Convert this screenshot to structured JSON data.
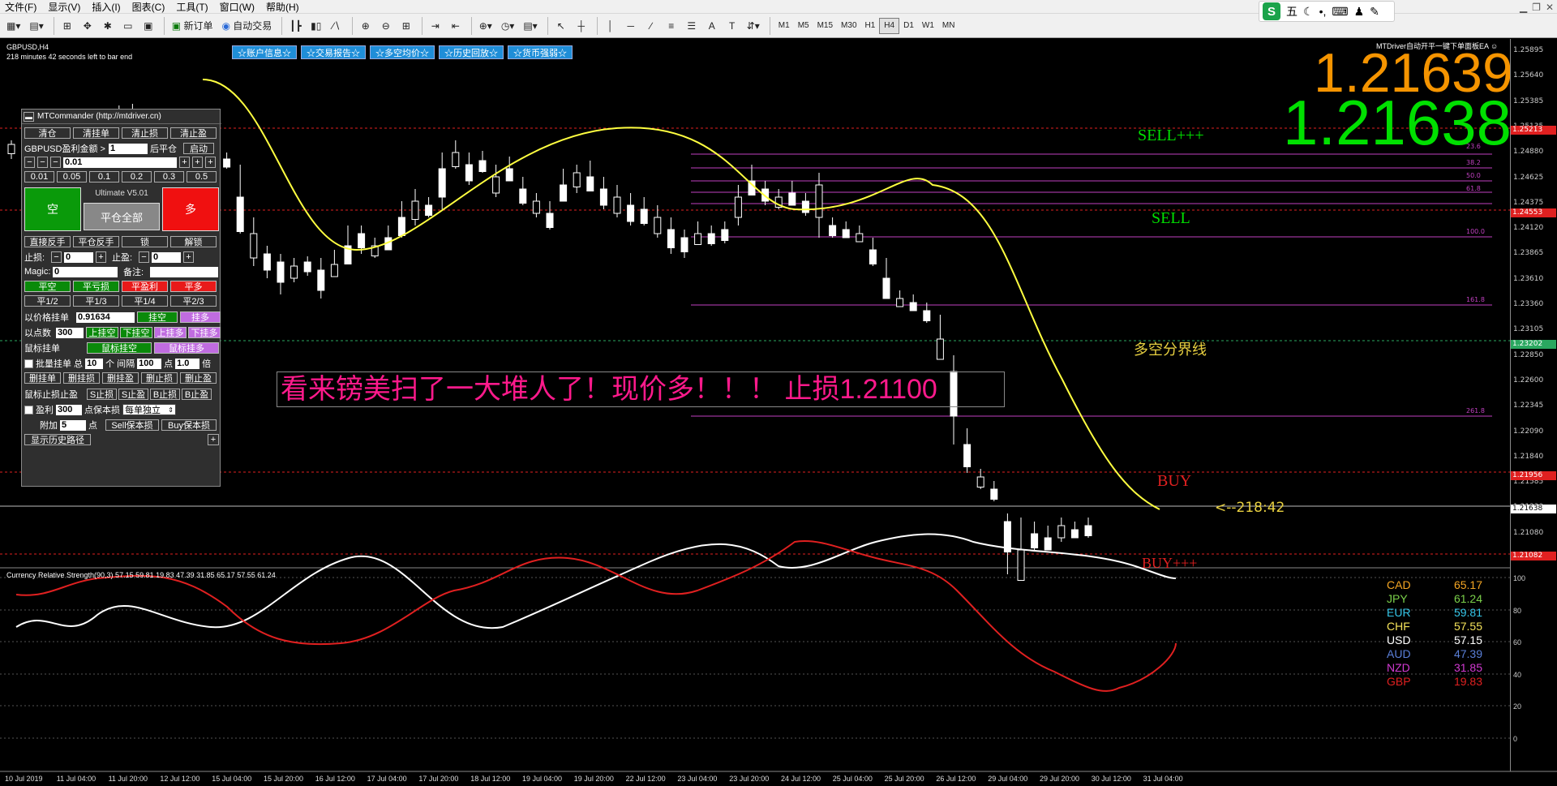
{
  "menu": [
    "文件(F)",
    "显示(V)",
    "插入(I)",
    "图表(C)",
    "工具(T)",
    "窗口(W)",
    "帮助(H)"
  ],
  "toolbar": {
    "new_order": "新订单",
    "auto_trade": "自动交易",
    "timeframes": [
      "M1",
      "M5",
      "M15",
      "M30",
      "H1",
      "H4",
      "D1",
      "W1",
      "MN"
    ],
    "active_timeframe": "H4"
  },
  "ime": {
    "logo": "S",
    "mode": "五"
  },
  "chart": {
    "symbol": "GBPUSD,H4",
    "countdown": "218 minutes 42 seconds left to bar end",
    "top_buttons": [
      "☆账户信息☆",
      "☆交易报告☆",
      "☆多空均价☆",
      "☆历史回放☆",
      "☆货币强弱☆"
    ],
    "ea_tag": "MTDriver自动开平一键下单面板EA ☺",
    "bid_display": "1.21639",
    "ask_display": "1.21638",
    "levels": {
      "sell_plus": "SELL+++",
      "sell": "SELL",
      "divider": "多空分界线",
      "buy": "BUY",
      "buy_plus": "BUY+++"
    },
    "fib_labels": [
      "23.6",
      "38.2",
      "50.0",
      "61.8",
      "100.0",
      "161.8",
      "261.8"
    ],
    "countdown_label": "<--218:42",
    "annotation": "看来镑美扫了一大堆人了！现价多！！！ 止损1.21100",
    "price_ticks": [
      "1.25895",
      "1.25640",
      "1.25385",
      "1.25135",
      "1.24880",
      "1.24625",
      "1.24375",
      "1.24120",
      "1.23865",
      "1.23610",
      "1.23360",
      "1.23105",
      "1.22850",
      "1.22600",
      "1.22345",
      "1.22090",
      "1.21840",
      "1.21585",
      "1.21330",
      "1.21080"
    ],
    "price_boxes": {
      "sell_plus": "1.25213",
      "sell": "1.24553",
      "divider": "1.23202",
      "buy": "1.21956",
      "current": "1.21638",
      "buy_plus": "1.21082"
    }
  },
  "commander": {
    "title": "MTCommander (http://mtdriver.cn)",
    "row1": [
      "清仓",
      "清挂单",
      "清止损",
      "清止盈"
    ],
    "profit_label": "GBPUSD盈利金额 >",
    "profit_value": "1",
    "after_close": "后平仓",
    "start": "启动",
    "lot": "0.01",
    "lot_presets": [
      "0.01",
      "0.05",
      "0.1",
      "0.2",
      "0.3",
      "0.5"
    ],
    "sell": "空",
    "buy": "多",
    "version": "Ultimate V5.01",
    "close_all": "平仓全部",
    "row_reverse": [
      "直接反手",
      "平仓反手",
      "锁",
      "解锁"
    ],
    "sl_label": "止损:",
    "sl_value": "0",
    "tp_label": "止盈:",
    "tp_value": "0",
    "magic_label": "Magic:",
    "magic_value": "0",
    "note_label": "备注:",
    "close_row": [
      "平空",
      "平亏损",
      "平盈利",
      "平多"
    ],
    "partial_row": [
      "平1/2",
      "平1/3",
      "平1/4",
      "平2/3"
    ],
    "price_pending_label": "以价格挂单",
    "price_pending_value": "0.91634",
    "pending_sell": "挂空",
    "pending_buy": "挂多",
    "points_label": "以点数",
    "points_value": "300",
    "points_btns": [
      "上挂空",
      "下挂空",
      "上挂多",
      "下挂多"
    ],
    "mouse_label": "鼠标挂单",
    "mouse_sell": "鼠标挂空",
    "mouse_buy": "鼠标挂多",
    "batch_label": "批量挂单 总",
    "batch_count": "10",
    "batch_unit": "个 间隔",
    "batch_gap": "100",
    "batch_pt": "点",
    "batch_mult": "1.0",
    "batch_mult_unit": "倍",
    "delete_row": [
      "删挂单",
      "删挂损",
      "删挂盈",
      "删止损",
      "删止盈"
    ],
    "mouse_sltp_label": "鼠标止损止盈",
    "mouse_sltp_btns": [
      "S止损",
      "S止盈",
      "B止损",
      "B止盈"
    ],
    "breakeven_label": "盈利",
    "breakeven_value": "300",
    "breakeven_unit": "点保本损",
    "breakeven_mode": "每单独立",
    "add_label": "附加",
    "add_value": "5",
    "add_unit": "点",
    "sell_be": "Sell保本损",
    "buy_be": "Buy保本损",
    "history": "显示历史路径"
  },
  "indicator": {
    "title": "Currency Relative Strength(90,3) 57.15 59.81 19.83 47.39 31.85 65.17 57.55 61.24",
    "legend": [
      {
        "name": "CAD",
        "value": "65.17",
        "color": "#f5a623"
      },
      {
        "name": "JPY",
        "value": "61.24",
        "color": "#7bd14a"
      },
      {
        "name": "EUR",
        "value": "59.81",
        "color": "#35c6e8"
      },
      {
        "name": "CHF",
        "value": "57.55",
        "color": "#f5e35a"
      },
      {
        "name": "USD",
        "value": "57.15",
        "color": "#ffffff"
      },
      {
        "name": "AUD",
        "value": "47.39",
        "color": "#5a7fd8"
      },
      {
        "name": "NZD",
        "value": "31.85",
        "color": "#d23ad2"
      },
      {
        "name": "GBP",
        "value": "19.83",
        "color": "#e02020"
      }
    ],
    "y_ticks": [
      "100",
      "80",
      "60",
      "40",
      "20",
      "0"
    ]
  },
  "x_ticks": [
    "10 Jul 2019",
    "11 Jul 04:00",
    "11 Jul 20:00",
    "12 Jul 12:00",
    "15 Jul 04:00",
    "15 Jul 20:00",
    "16 Jul 12:00",
    "17 Jul 04:00",
    "17 Jul 20:00",
    "18 Jul 12:00",
    "19 Jul 04:00",
    "19 Jul 20:00",
    "22 Jul 12:00",
    "23 Jul 04:00",
    "23 Jul 20:00",
    "24 Jul 12:00",
    "25 Jul 04:00",
    "25 Jul 20:00",
    "26 Jul 12:00",
    "29 Jul 04:00",
    "29 Jul 20:00",
    "30 Jul 12:00",
    "31 Jul 04:00"
  ],
  "colors": {
    "bull": "#ffffff",
    "bear": "#ffffff",
    "ma": "#ffff40",
    "usd": "#ffffff",
    "gbp": "#e02020",
    "fib": "#c040c0",
    "level_red": "#e02020"
  }
}
